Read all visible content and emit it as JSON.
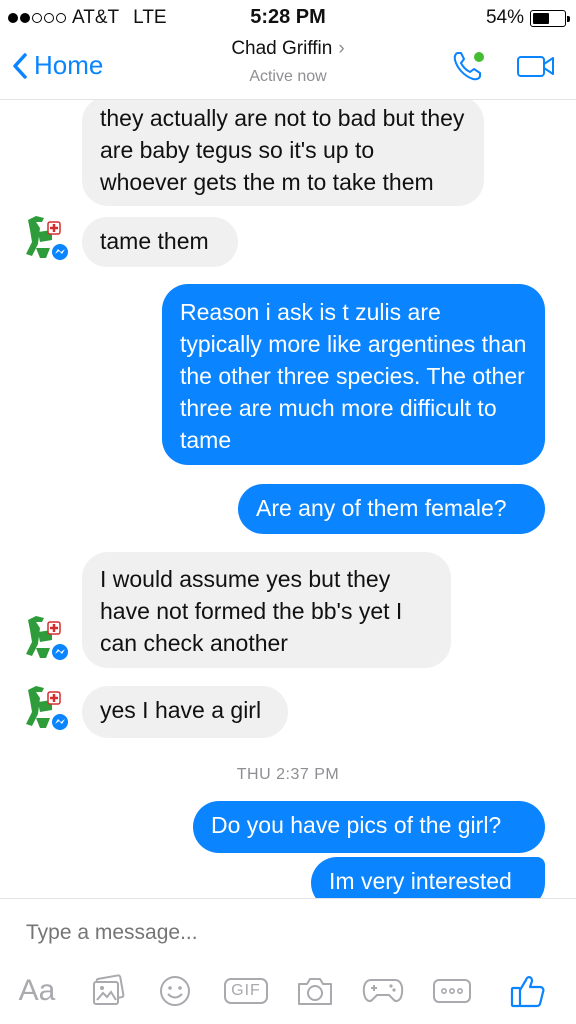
{
  "status_bar": {
    "carrier": "AT&T",
    "network": "LTE",
    "time": "5:28 PM",
    "battery_text": "54%",
    "battery_level": 0.54,
    "signal_bars": 2
  },
  "header": {
    "back_label": "Home",
    "contact_name": "Chad Griffin",
    "contact_status": "Active now",
    "accent_color": "#0a84ff",
    "active_dot_color": "#44bd32"
  },
  "messages": [
    {
      "side": "in",
      "text": "they actually are not to bad but they are baby tegus so it's up to whoever gets the m to take them"
    },
    {
      "side": "in",
      "text": "tame them"
    },
    {
      "side": "out",
      "text": "Reason i ask is t zulis are typically more like argentines than the other three species. The other three are much more difficult to tame"
    },
    {
      "side": "out",
      "text": "Are any of them female?"
    },
    {
      "side": "in",
      "text": "I would assume yes but they have not formed the bb's yet I can check another"
    },
    {
      "side": "in",
      "text": "yes I have a girl"
    },
    {
      "side": "out",
      "text": "Do you have pics of the girl?"
    },
    {
      "side": "out",
      "text": "Im very interested"
    }
  ],
  "timestamp": "THU 2:37 PM",
  "composer": {
    "placeholder": "Type a message...",
    "aa_label": "Aa",
    "gif_label": "GIF",
    "toolbar_icons": [
      "text-format-icon",
      "photo-icon",
      "emoji-icon",
      "gif-icon",
      "camera-icon",
      "game-controller-icon",
      "more-icon",
      "thumbs-up-icon"
    ]
  }
}
